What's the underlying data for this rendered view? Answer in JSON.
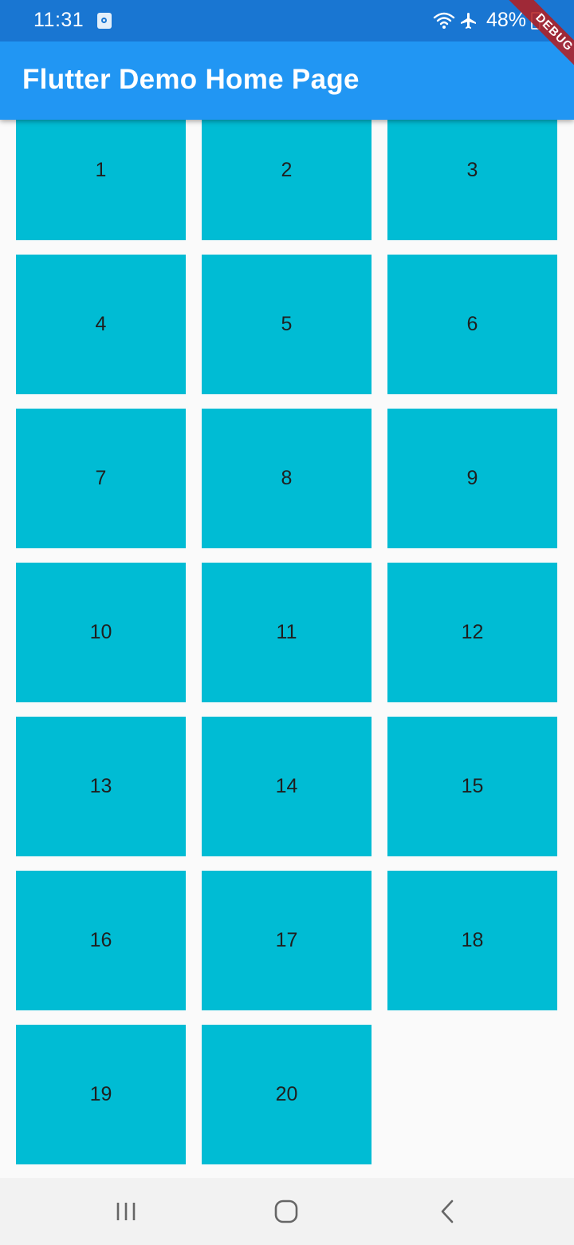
{
  "status_bar": {
    "time": "11:31",
    "battery": "48%",
    "icons": [
      "app-notification-icon",
      "wifi-icon",
      "airplane-mode-icon",
      "battery-icon"
    ]
  },
  "app_bar": {
    "title": "Flutter Demo Home Page"
  },
  "debug_banner": {
    "label": "DEBUG"
  },
  "grid": {
    "tile_color": "#00bcd4",
    "tiles": [
      {
        "label": "1"
      },
      {
        "label": "2"
      },
      {
        "label": "3"
      },
      {
        "label": "4"
      },
      {
        "label": "5"
      },
      {
        "label": "6"
      },
      {
        "label": "7"
      },
      {
        "label": "8"
      },
      {
        "label": "9"
      },
      {
        "label": "10"
      },
      {
        "label": "11"
      },
      {
        "label": "12"
      },
      {
        "label": "13"
      },
      {
        "label": "14"
      },
      {
        "label": "15"
      },
      {
        "label": "16"
      },
      {
        "label": "17"
      },
      {
        "label": "18"
      },
      {
        "label": "19"
      },
      {
        "label": "20"
      }
    ]
  },
  "nav_bar": {
    "buttons": [
      "recents-icon",
      "home-icon",
      "back-icon"
    ]
  },
  "colors": {
    "status_bar": "#1976d2",
    "app_bar": "#2196f3",
    "background": "#fafafa",
    "nav_bar": "#f2f2f2"
  }
}
